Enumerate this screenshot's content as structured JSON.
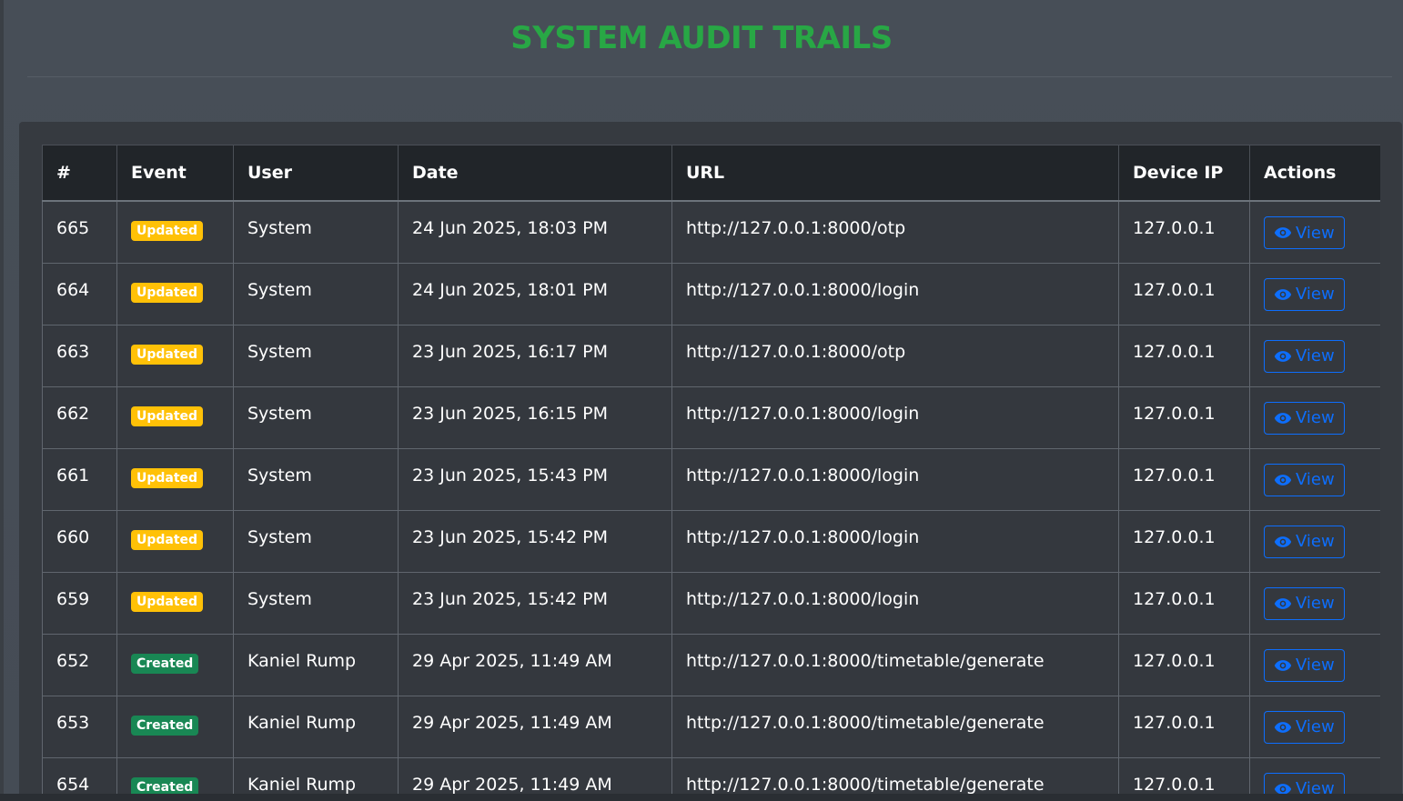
{
  "page": {
    "title": "SYSTEM AUDIT TRAILS"
  },
  "table": {
    "headers": [
      "#",
      "Event",
      "User",
      "Date",
      "URL",
      "Device IP",
      "Actions"
    ],
    "action_label": "View",
    "rows": [
      {
        "id": "665",
        "event": "Updated",
        "user": "System",
        "date": "24 Jun 2025, 18:03 PM",
        "url": "http://127.0.0.1:8000/otp",
        "ip": "127.0.0.1"
      },
      {
        "id": "664",
        "event": "Updated",
        "user": "System",
        "date": "24 Jun 2025, 18:01 PM",
        "url": "http://127.0.0.1:8000/login",
        "ip": "127.0.0.1"
      },
      {
        "id": "663",
        "event": "Updated",
        "user": "System",
        "date": "23 Jun 2025, 16:17 PM",
        "url": "http://127.0.0.1:8000/otp",
        "ip": "127.0.0.1"
      },
      {
        "id": "662",
        "event": "Updated",
        "user": "System",
        "date": "23 Jun 2025, 16:15 PM",
        "url": "http://127.0.0.1:8000/login",
        "ip": "127.0.0.1"
      },
      {
        "id": "661",
        "event": "Updated",
        "user": "System",
        "date": "23 Jun 2025, 15:43 PM",
        "url": "http://127.0.0.1:8000/login",
        "ip": "127.0.0.1"
      },
      {
        "id": "660",
        "event": "Updated",
        "user": "System",
        "date": "23 Jun 2025, 15:42 PM",
        "url": "http://127.0.0.1:8000/login",
        "ip": "127.0.0.1"
      },
      {
        "id": "659",
        "event": "Updated",
        "user": "System",
        "date": "23 Jun 2025, 15:42 PM",
        "url": "http://127.0.0.1:8000/login",
        "ip": "127.0.0.1"
      },
      {
        "id": "652",
        "event": "Created",
        "user": "Kaniel Rump",
        "date": "29 Apr 2025, 11:49 AM",
        "url": "http://127.0.0.1:8000/timetable/generate",
        "ip": "127.0.0.1"
      },
      {
        "id": "653",
        "event": "Created",
        "user": "Kaniel Rump",
        "date": "29 Apr 2025, 11:49 AM",
        "url": "http://127.0.0.1:8000/timetable/generate",
        "ip": "127.0.0.1"
      },
      {
        "id": "654",
        "event": "Created",
        "user": "Kaniel Rump",
        "date": "29 Apr 2025, 11:49 AM",
        "url": "http://127.0.0.1:8000/timetable/generate",
        "ip": "127.0.0.1"
      }
    ]
  },
  "colors": {
    "title": "#28a745",
    "updated_badge": "#ffc107",
    "created_badge": "#198754",
    "view_button": "#0d6efd"
  },
  "icons": {
    "view": "eye-icon"
  }
}
